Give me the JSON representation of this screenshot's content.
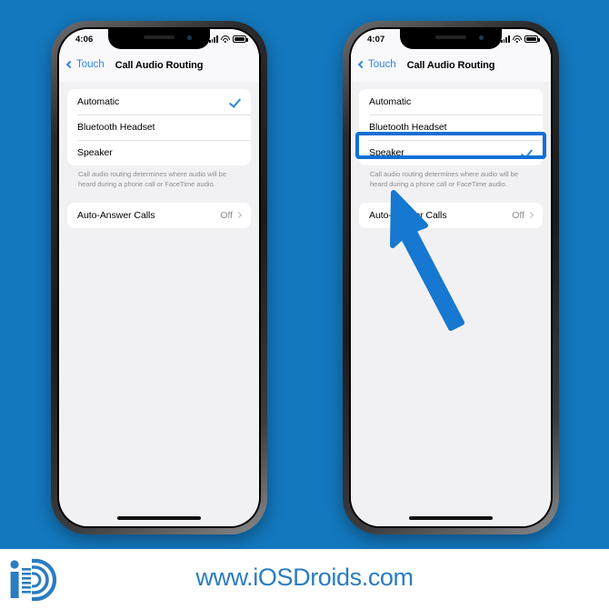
{
  "background_color": "#1378be",
  "accent_blue": "#2f84e0",
  "highlight_blue": "#0f6fd6",
  "phones": [
    {
      "id": "phone-1",
      "status": {
        "time": "4:06",
        "icons": [
          "cellular-signal-icon",
          "wifi-icon",
          "battery-icon"
        ]
      },
      "nav": {
        "back_label": "Touch",
        "title": "Call Audio Routing"
      },
      "options": [
        {
          "label": "Automatic",
          "selected": true
        },
        {
          "label": "Bluetooth Headset",
          "selected": false
        },
        {
          "label": "Speaker",
          "selected": false
        }
      ],
      "footnote": "Call audio routing determines where audio will be heard during a phone call or FaceTime audio.",
      "auto_answer": {
        "label": "Auto-Answer Calls",
        "value": "Off"
      },
      "highlight": false
    },
    {
      "id": "phone-2",
      "status": {
        "time": "4:07",
        "icons": [
          "cellular-signal-icon",
          "wifi-icon",
          "battery-icon"
        ]
      },
      "nav": {
        "back_label": "Touch",
        "title": "Call Audio Routing"
      },
      "options": [
        {
          "label": "Automatic",
          "selected": false
        },
        {
          "label": "Bluetooth Headset",
          "selected": false
        },
        {
          "label": "Speaker",
          "selected": true
        }
      ],
      "footnote": "Call audio routing determines where audio will be heard during a phone call or FaceTime audio.",
      "auto_answer": {
        "label": "Auto-Answer Calls",
        "value": "Off"
      },
      "highlight": true,
      "highlight_target": "Speaker"
    }
  ],
  "annotation": {
    "type": "arrow",
    "color": "#1678d0",
    "points_to": "speaker-row-phone-2"
  },
  "footer": {
    "url_text": "www.iOSDroids.com",
    "url_color": "#2b7cc0",
    "logo_name": "iosdroids-logo",
    "logo_color": "#2b7cc0"
  }
}
